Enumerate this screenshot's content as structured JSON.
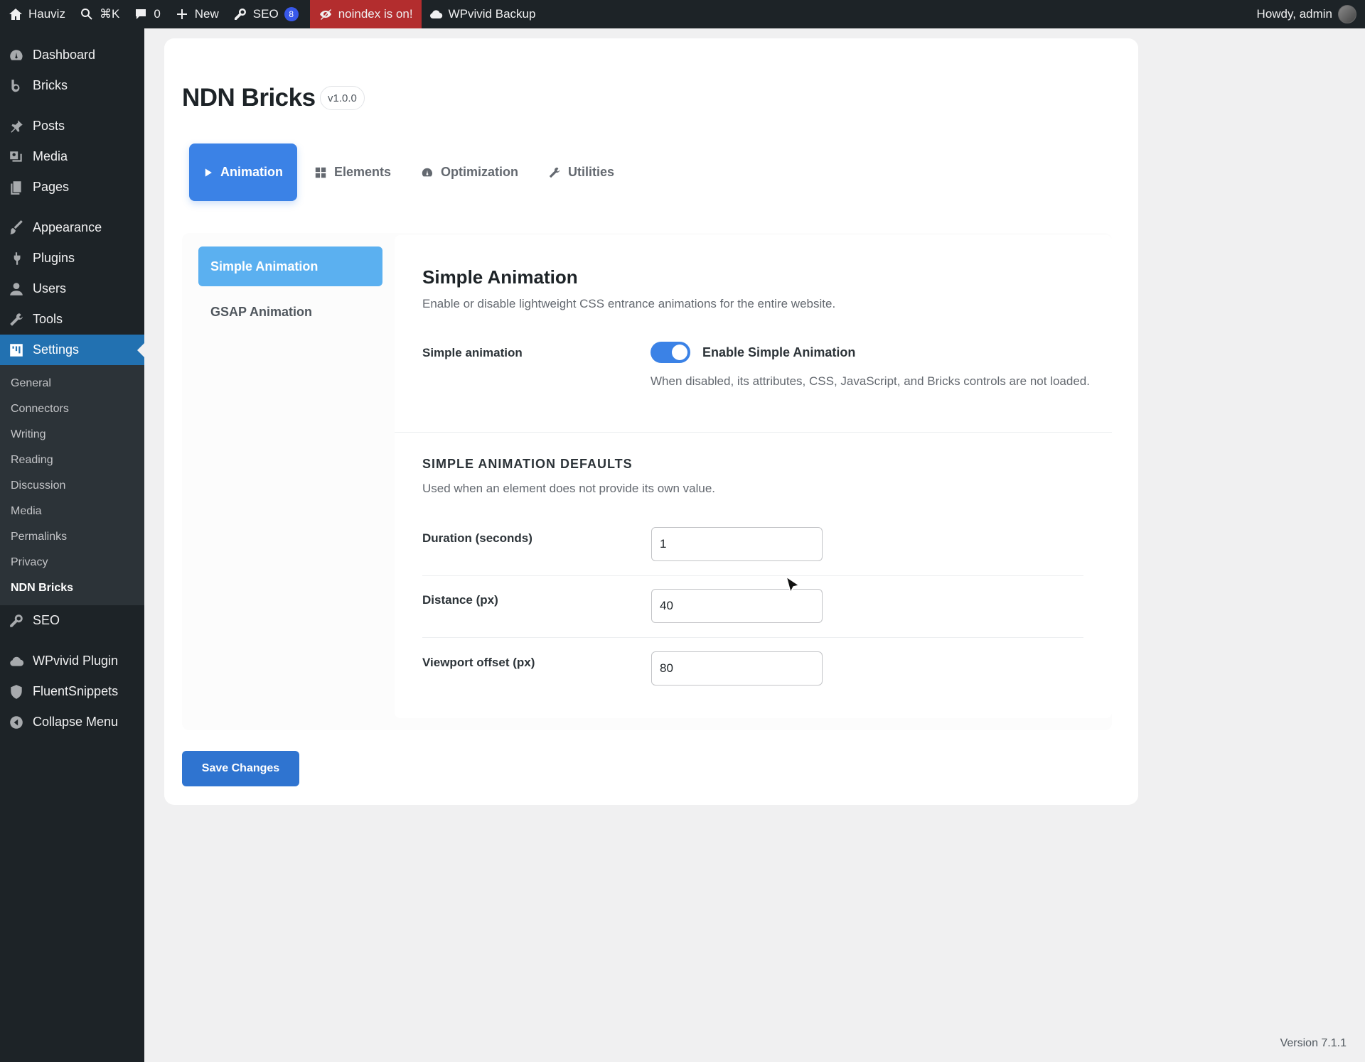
{
  "adminbar": {
    "site_name": "Hauviz",
    "search_shortcut": "⌘K",
    "comments_count": "0",
    "new_label": "New",
    "seo_label": "SEO",
    "seo_count": "8",
    "noindex_label": "noindex is on!",
    "backup_label": "WPvivid Backup",
    "howdy": "Howdy, admin"
  },
  "sidebar": {
    "items": [
      {
        "label": "Dashboard"
      },
      {
        "label": "Bricks"
      },
      {
        "label": "Posts"
      },
      {
        "label": "Media"
      },
      {
        "label": "Pages"
      },
      {
        "label": "Appearance"
      },
      {
        "label": "Plugins"
      },
      {
        "label": "Users"
      },
      {
        "label": "Tools"
      },
      {
        "label": "Settings"
      },
      {
        "label": "SEO"
      },
      {
        "label": "WPvivid Plugin"
      },
      {
        "label": "FluentSnippets"
      },
      {
        "label": "Collapse Menu"
      }
    ],
    "submenu": [
      "General",
      "Connectors",
      "Writing",
      "Reading",
      "Discussion",
      "Media",
      "Permalinks",
      "Privacy",
      "NDN Bricks"
    ]
  },
  "page": {
    "title": "NDN Bricks",
    "version": "v1.0.0",
    "tabs": [
      {
        "label": "Animation",
        "icon": "play-icon"
      },
      {
        "label": "Elements",
        "icon": "grid-icon"
      },
      {
        "label": "Optimization",
        "icon": "gauge-icon"
      },
      {
        "label": "Utilities",
        "icon": "wrench-icon"
      }
    ],
    "subnav": [
      "Simple Animation",
      "GSAP Animation"
    ],
    "section_title": "Simple Animation",
    "section_desc": "Enable or disable lightweight CSS entrance animations for the entire website.",
    "toggle_field_label": "Simple animation",
    "toggle_label": "Enable Simple Animation",
    "toggle_on": true,
    "toggle_help": "When disabled, its attributes, CSS, JavaScript, and Bricks controls are not loaded.",
    "defaults_title": "SIMPLE ANIMATION DEFAULTS",
    "defaults_desc": "Used when an element does not provide its own value.",
    "fields": [
      {
        "label": "Duration (seconds)",
        "value": "1"
      },
      {
        "label": "Distance (px)",
        "value": "40"
      },
      {
        "label": "Viewport offset (px)",
        "value": "80"
      }
    ],
    "save_label": "Save Changes"
  },
  "footer": {
    "version": "Version 7.1.1"
  },
  "colors": {
    "accent": "#3b82e6",
    "admin_dark": "#1d2327",
    "noindex_red": "#b32d2e"
  }
}
